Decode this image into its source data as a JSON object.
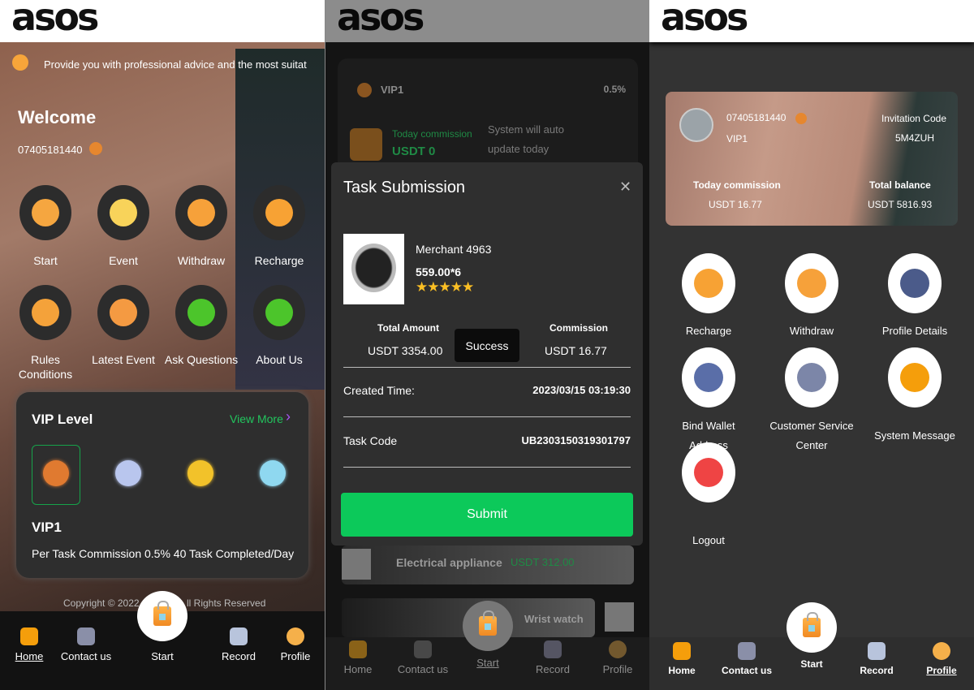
{
  "brand": "asos",
  "home": {
    "notice": "Provide you with professional advice and the most suitat",
    "welcome": "Welcome",
    "phone": "07405181440",
    "menu": [
      {
        "label": "Start",
        "icon": "shopping-bag-icon",
        "color": "#f5a640"
      },
      {
        "label": "Event",
        "icon": "award-certificate-icon",
        "color": "#f8d35a"
      },
      {
        "label": "Withdraw",
        "icon": "hand-coin-icon",
        "color": "#f6a13a"
      },
      {
        "label": "Recharge",
        "icon": "coins-icon",
        "color": "#f7a234"
      },
      {
        "label": "Rules\nConditions",
        "icon": "gavel-icon",
        "color": "#f4a23a"
      },
      {
        "label": "Latest Event",
        "icon": "medal-icon",
        "color": "#f49a42"
      },
      {
        "label": "Ask Questions",
        "icon": "question-icon",
        "color": "#4cc52b"
      },
      {
        "label": "About Us",
        "icon": "info-icon",
        "color": "#4cc52b"
      }
    ],
    "vip": {
      "title": "VIP Level",
      "view_more": "View More",
      "badges": [
        "#e07a30",
        "#b9c6ee",
        "#f2c22a",
        "#8fd8f0"
      ],
      "level": "VIP1",
      "desc": "Per Task Commission 0.5% 40 Task Completed/Day"
    },
    "copyright": "Copyright © 2022",
    "copyright_tail": "ll Rights Reserved"
  },
  "nav": {
    "home": "Home",
    "contact": "Contact us",
    "start": "Start",
    "record": "Record",
    "profile": "Profile"
  },
  "task": {
    "vip": "VIP1",
    "rate": "0.5%",
    "today_label": "Today commission",
    "today_value": "USDT 0",
    "sys_note": "System will auto update today",
    "modal": {
      "title": "Task Submission",
      "merchant": "Merchant 4963",
      "price": "559.00*6",
      "rating": 5,
      "total_label": "Total Amount",
      "total_value": "USDT 3354.00",
      "status": "Success",
      "comm_label": "Commission",
      "comm_value": "USDT 16.77",
      "created_label": "Created Time:",
      "created_value": "2023/03/15 03:19:30",
      "code_label": "Task Code",
      "code_value": "UB2303150319301797",
      "submit": "Submit"
    },
    "items": [
      {
        "name": "Electrical appliance",
        "price": "USDT 312.00"
      },
      {
        "name": "Wrist watch"
      }
    ]
  },
  "profile": {
    "phone": "07405181440",
    "vip": "VIP1",
    "invite_label": "Invitation Code",
    "invite_code": "5M4ZUH",
    "today_label": "Today commission",
    "today_value": "USDT 16.77",
    "balance_label": "Total balance",
    "balance_value": "USDT 5816.93",
    "menu": [
      {
        "label": "Recharge",
        "icon": "coins-icon"
      },
      {
        "label": "Withdraw",
        "icon": "hand-coin-icon"
      },
      {
        "label": "Profile Details",
        "icon": "gear-icon"
      },
      {
        "label": "Bind Wallet\nAddress",
        "icon": "wallet-card-icon"
      },
      {
        "label": "Customer Service\nCenter",
        "icon": "chat-icon"
      },
      {
        "label": "System Message",
        "icon": "bell-icon"
      },
      {
        "label": "Logout",
        "icon": "logout-door-icon"
      }
    ]
  },
  "colors": {
    "accent_green": "#0cc95a",
    "view_more": "#22c55e",
    "chevron": "#a855f7"
  }
}
